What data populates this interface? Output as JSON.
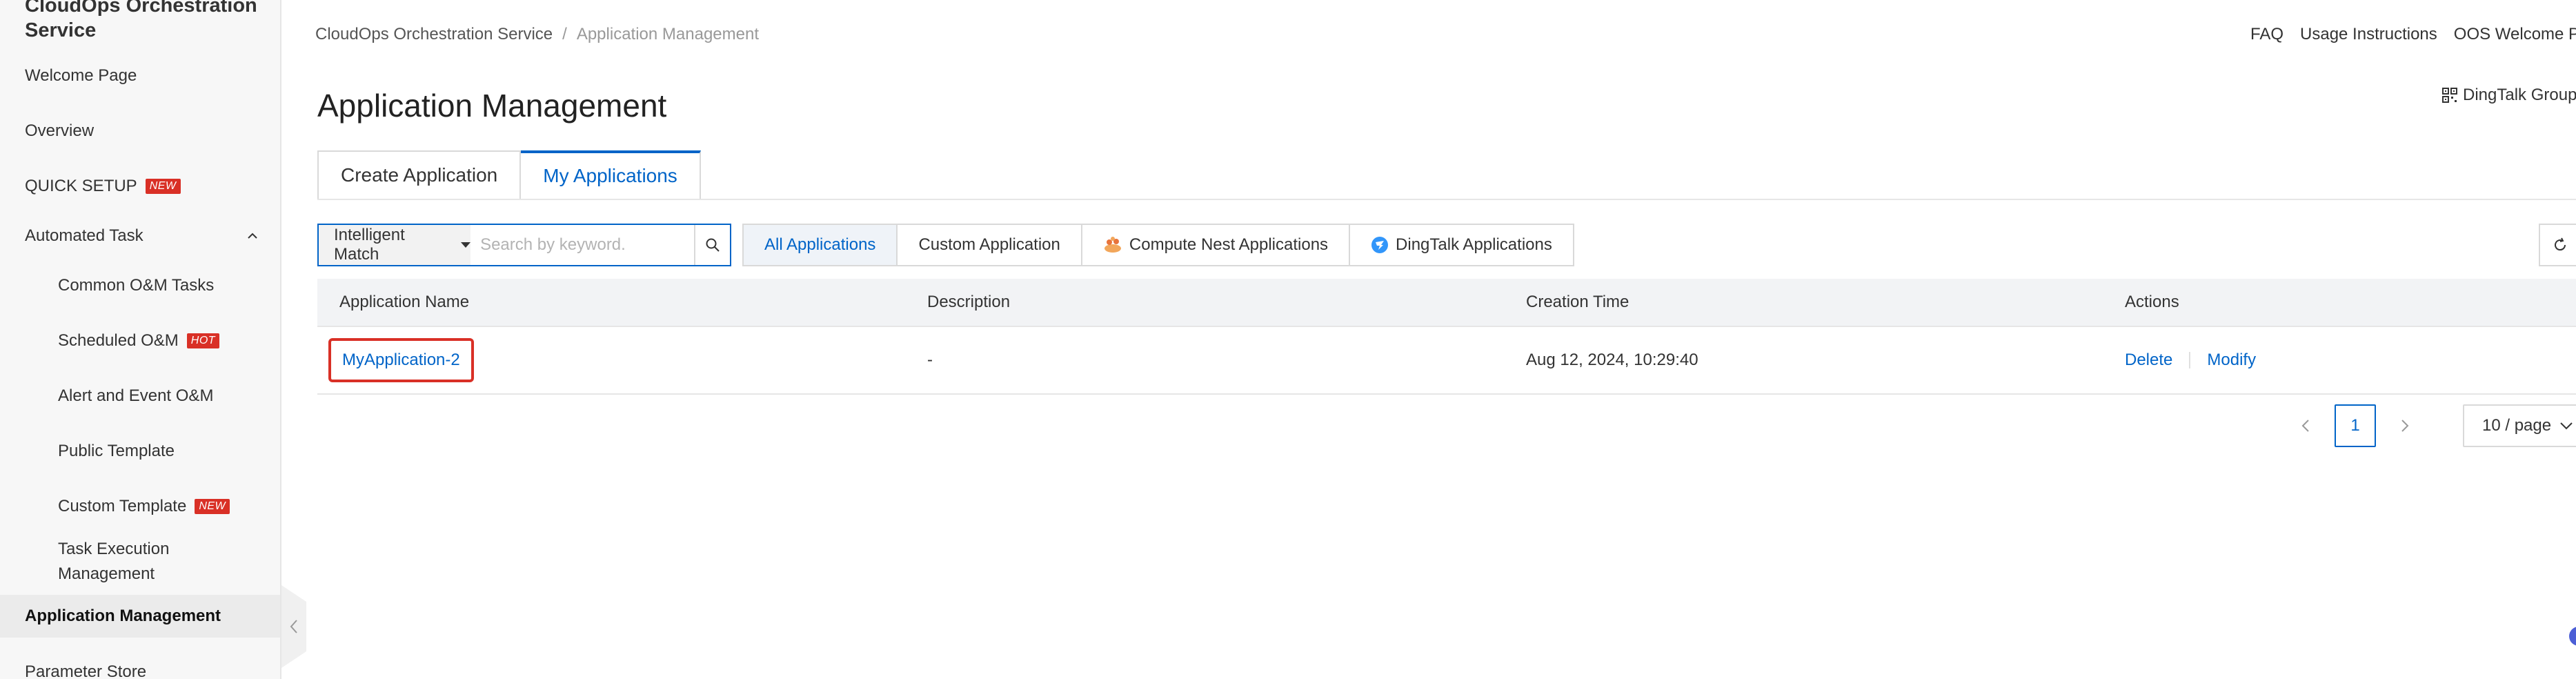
{
  "sidebar": {
    "title": "CloudOps Orchestration Service",
    "items": [
      {
        "label": "Welcome Page"
      },
      {
        "label": "Overview"
      },
      {
        "label": "QUICK SETUP",
        "badge": "NEW"
      },
      {
        "label": "Automated Task"
      },
      {
        "label": "Common O&M Tasks"
      },
      {
        "label": "Scheduled O&M",
        "badge": "HOT"
      },
      {
        "label": "Alert and Event O&M"
      },
      {
        "label": "Public Template"
      },
      {
        "label": "Custom Template",
        "badge": "NEW"
      },
      {
        "label": "Task Execution Management"
      },
      {
        "label": "Application Management"
      },
      {
        "label": "Parameter Store"
      }
    ]
  },
  "header": {
    "breadcrumb": [
      "CloudOps Orchestration Service",
      "/",
      "Application Management"
    ],
    "links": [
      "FAQ",
      "Usage Instructions",
      "OOS Welcome P"
    ],
    "dingtalk_group": "DingTalk Group"
  },
  "page": {
    "title": "Application Management"
  },
  "tabs": [
    {
      "label": "Create Application"
    },
    {
      "label": "My Applications",
      "active": true
    }
  ],
  "search": {
    "match_mode": "Intelligent Match",
    "placeholder": "Search by keyword.",
    "value": ""
  },
  "filters": [
    {
      "label": "All Applications",
      "active": true
    },
    {
      "label": "Custom Application"
    },
    {
      "label": "Compute Nest Applications",
      "icon": "compute-nest-icon"
    },
    {
      "label": "DingTalk Applications",
      "icon": "dingtalk-icon"
    }
  ],
  "table": {
    "columns": [
      "Application Name",
      "Description",
      "Creation Time",
      "Actions"
    ],
    "rows": [
      {
        "name": "MyApplication-2",
        "description": "-",
        "created": "Aug 12, 2024, 10:29:40",
        "actions": [
          "Delete",
          "Modify"
        ]
      }
    ]
  },
  "pagination": {
    "current_page": "1",
    "page_size": "10 / page"
  },
  "colors": {
    "accent": "#0064c8",
    "badge": "#d93026",
    "highlight": "#d93026"
  }
}
